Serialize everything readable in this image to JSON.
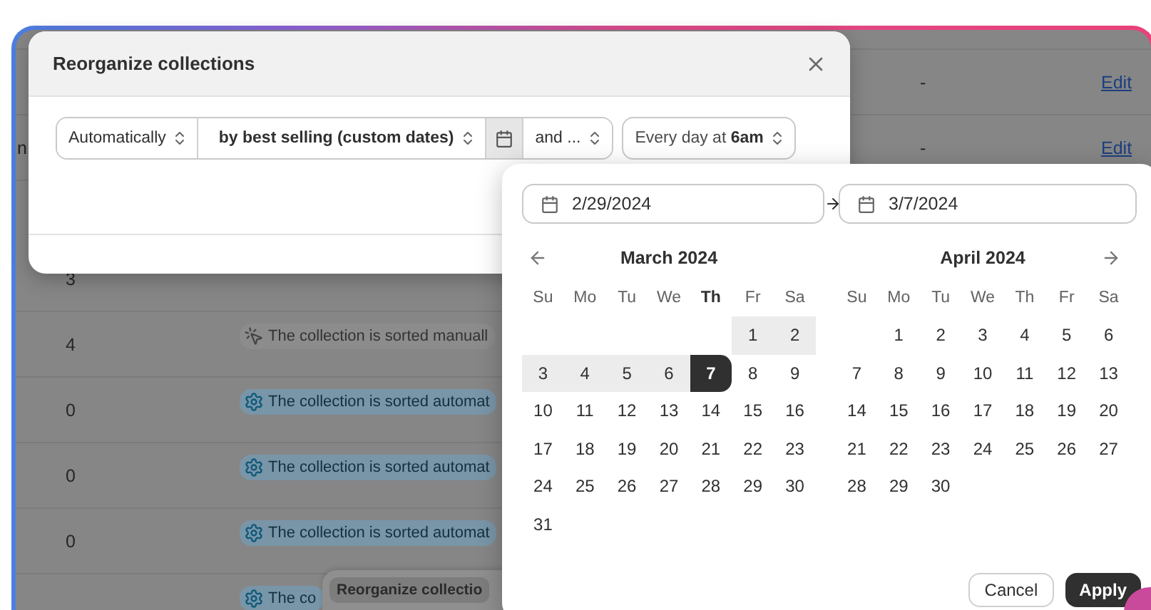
{
  "table": {
    "rows": [
      {
        "kind": "link",
        "value": "-",
        "link": "Edit"
      },
      {
        "kind": "link",
        "edge_text": "n",
        "value": "-",
        "link": "Edit"
      },
      {
        "kind": "status",
        "count": "3"
      },
      {
        "kind": "status",
        "count": "4",
        "status": {
          "kind": "manual",
          "text": "The collection is sorted manuall"
        }
      },
      {
        "kind": "status",
        "count": "0",
        "status": {
          "kind": "auto",
          "text": "The collection is sorted automat"
        }
      },
      {
        "kind": "status",
        "count": "0",
        "status": {
          "kind": "auto",
          "text": "The collection is sorted automat"
        }
      },
      {
        "kind": "status",
        "count": "0",
        "status": {
          "kind": "auto",
          "text": "The collection is sorted automat"
        }
      },
      {
        "kind": "status",
        "status": {
          "kind": "auto",
          "text": "The co"
        }
      }
    ]
  },
  "toast": {
    "label": "Reorganize collectio"
  },
  "modal": {
    "title": "Reorganize collections",
    "sort_controls": [
      {
        "kind": "select",
        "label": "Automatically",
        "emphasis": false
      },
      {
        "kind": "select",
        "label": "by best selling (custom dates)",
        "emphasis": true
      },
      {
        "kind": "date_button",
        "selected": true
      },
      {
        "kind": "select",
        "label": "and ...",
        "emphasis": false
      }
    ],
    "schedule": {
      "label": "Every day at **6am**"
    }
  },
  "date_picker": {
    "start": "2/29/2024",
    "end": "3/7/2024",
    "months": [
      {
        "title": "March 2024",
        "weekdays": [
          {
            "label": "Su",
            "current": false
          },
          {
            "label": "Mo",
            "current": false
          },
          {
            "label": "Tu",
            "current": false
          },
          {
            "label": "We",
            "current": false
          },
          {
            "label": "Th",
            "current": true
          },
          {
            "label": "Fr",
            "current": false
          },
          {
            "label": "Sa",
            "current": false
          }
        ],
        "weeks": [
          [
            {
              "day": "1",
              "in_range": true,
              "selected": false
            },
            {
              "day": "2",
              "in_range": true,
              "selected": false
            }
          ],
          [
            {
              "day": "3",
              "in_range": true,
              "selected": false
            },
            {
              "day": "4",
              "in_range": true,
              "selected": false
            },
            {
              "day": "5",
              "in_range": true,
              "selected": false
            },
            {
              "day": "6",
              "in_range": true,
              "selected": false
            },
            {
              "day": "7",
              "in_range": true,
              "selected": true
            },
            {
              "day": "8",
              "in_range": false,
              "selected": false
            },
            {
              "day": "9",
              "in_range": false,
              "selected": false
            }
          ],
          [
            {
              "day": "10",
              "in_range": false,
              "selected": false
            },
            {
              "day": "11",
              "in_range": false,
              "selected": false
            },
            {
              "day": "12",
              "in_range": false,
              "selected": false
            },
            {
              "day": "13",
              "in_range": false,
              "selected": false
            },
            {
              "day": "14",
              "in_range": false,
              "selected": false
            },
            {
              "day": "15",
              "in_range": false,
              "selected": false
            },
            {
              "day": "16",
              "in_range": false,
              "selected": false
            }
          ],
          [
            {
              "day": "17",
              "in_range": false,
              "selected": false
            },
            {
              "day": "18",
              "in_range": false,
              "selected": false
            },
            {
              "day": "19",
              "in_range": false,
              "selected": false
            },
            {
              "day": "20",
              "in_range": false,
              "selected": false
            },
            {
              "day": "21",
              "in_range": false,
              "selected": false
            },
            {
              "day": "22",
              "in_range": false,
              "selected": false
            },
            {
              "day": "23",
              "in_range": false,
              "selected": false
            }
          ],
          [
            {
              "day": "24",
              "in_range": false,
              "selected": false
            },
            {
              "day": "25",
              "in_range": false,
              "selected": false
            },
            {
              "day": "26",
              "in_range": false,
              "selected": false
            },
            {
              "day": "27",
              "in_range": false,
              "selected": false
            },
            {
              "day": "28",
              "in_range": false,
              "selected": false
            },
            {
              "day": "29",
              "in_range": false,
              "selected": false
            },
            {
              "day": "30",
              "in_range": false,
              "selected": false
            }
          ],
          [
            {
              "day": "31",
              "in_range": false,
              "selected": false
            }
          ]
        ]
      },
      {
        "title": "April 2024",
        "weekdays": [
          {
            "label": "Su",
            "current": false
          },
          {
            "label": "Mo",
            "current": false
          },
          {
            "label": "Tu",
            "current": false
          },
          {
            "label": "We",
            "current": false
          },
          {
            "label": "Th",
            "current": false
          },
          {
            "label": "Fr",
            "current": false
          },
          {
            "label": "Sa",
            "current": false
          }
        ],
        "weeks": [
          [
            {
              "day": "1",
              "in_range": false,
              "selected": false
            },
            {
              "day": "2",
              "in_range": false,
              "selected": false
            },
            {
              "day": "3",
              "in_range": false,
              "selected": false
            },
            {
              "day": "4",
              "in_range": false,
              "selected": false
            },
            {
              "day": "5",
              "in_range": false,
              "selected": false
            },
            {
              "day": "6",
              "in_range": false,
              "selected": false
            }
          ],
          [
            {
              "day": "7",
              "in_range": false,
              "selected": false
            },
            {
              "day": "8",
              "in_range": false,
              "selected": false
            },
            {
              "day": "9",
              "in_range": false,
              "selected": false
            },
            {
              "day": "10",
              "in_range": false,
              "selected": false
            },
            {
              "day": "11",
              "in_range": false,
              "selected": false
            },
            {
              "day": "12",
              "in_range": false,
              "selected": false
            },
            {
              "day": "13",
              "in_range": false,
              "selected": false
            }
          ],
          [
            {
              "day": "14",
              "in_range": false,
              "selected": false
            },
            {
              "day": "15",
              "in_range": false,
              "selected": false
            },
            {
              "day": "16",
              "in_range": false,
              "selected": false
            },
            {
              "day": "17",
              "in_range": false,
              "selected": false
            },
            {
              "day": "18",
              "in_range": false,
              "selected": false
            },
            {
              "day": "19",
              "in_range": false,
              "selected": false
            },
            {
              "day": "20",
              "in_range": false,
              "selected": false
            }
          ],
          [
            {
              "day": "21",
              "in_range": false,
              "selected": false
            },
            {
              "day": "22",
              "in_range": false,
              "selected": false
            },
            {
              "day": "23",
              "in_range": false,
              "selected": false
            },
            {
              "day": "24",
              "in_range": false,
              "selected": false
            },
            {
              "day": "25",
              "in_range": false,
              "selected": false
            },
            {
              "day": "26",
              "in_range": false,
              "selected": false
            },
            {
              "day": "27",
              "in_range": false,
              "selected": false
            }
          ],
          [
            {
              "day": "28",
              "in_range": false,
              "selected": false
            },
            {
              "day": "29",
              "in_range": false,
              "selected": false
            },
            {
              "day": "30",
              "in_range": false,
              "selected": false
            }
          ]
        ]
      }
    ],
    "buttons": {
      "cancel": "Cancel",
      "apply": "Apply"
    }
  }
}
